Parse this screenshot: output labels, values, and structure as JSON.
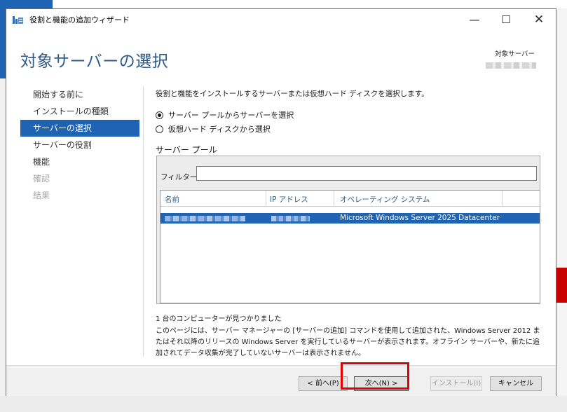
{
  "window": {
    "title": "役割と機能の追加ウィザード",
    "controls": {
      "minimize": "—",
      "maximize": "☐",
      "close": "✕"
    }
  },
  "header": {
    "title": "対象サーバーの選択",
    "dest_label": "対象サーバー"
  },
  "nav": {
    "items": [
      {
        "label": "開始する前に",
        "state": "normal"
      },
      {
        "label": "インストールの種類",
        "state": "normal"
      },
      {
        "label": "サーバーの選択",
        "state": "active"
      },
      {
        "label": "サーバーの役割",
        "state": "normal"
      },
      {
        "label": "機能",
        "state": "normal"
      },
      {
        "label": "確認",
        "state": "disabled"
      },
      {
        "label": "結果",
        "state": "disabled"
      }
    ]
  },
  "main": {
    "description": "役割と機能をインストールするサーバーまたは仮想ハード ディスクを選択します。",
    "radio_options": [
      {
        "label": "サーバー プールからサーバーを選択",
        "checked": true
      },
      {
        "label": "仮想ハード ディスクから選択",
        "checked": false
      }
    ],
    "pool_label": "サーバー プール",
    "filter_label": "フィルター:",
    "filter_value": "",
    "columns": [
      "名前",
      "IP アドレス",
      "オペレーティング システム"
    ],
    "rows": [
      {
        "os": "Microsoft Windows Server 2025 Datacenter",
        "selected": true
      }
    ],
    "count_text": "1 台のコンピューターが見つかりました",
    "note_text": "このページには、サーバー マネージャーの [サーバーの追加] コマンドを使用して追加された、Windows Server 2012 またはそれ以降のリリースの Windows Server を実行しているサーバーが表示されます。オフライン サーバーや、新たに追加されてデータ収集が完了していないサーバーは表示されません。"
  },
  "footer": {
    "prev": "< 前へ(P)",
    "next": "次へ(N) >",
    "install": "インストール(I)",
    "cancel": "キャンセル"
  },
  "colors": {
    "accent": "#1f63b5",
    "header_text": "#2e5c8a",
    "highlight": "#e00000"
  }
}
